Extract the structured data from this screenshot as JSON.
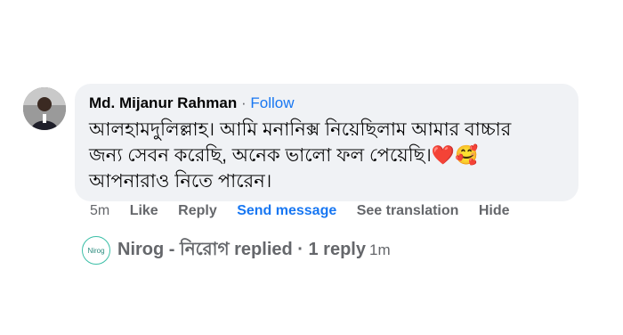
{
  "comment": {
    "author": "Md. Mijanur Rahman",
    "separator": "·",
    "follow_label": "Follow",
    "text_line1": "আলহামদুলিল্লাহ। আমি মনানিক্স নিয়েছিলাম আমার বাচ্চার",
    "text_line2": "জন্য সেবন করেছি, অনেক ভালো ফল পেয়েছি।",
    "text_line3": "আপনারাও নিতে পারেন।",
    "emoji1": "❤️",
    "emoji2": "🥰"
  },
  "actions": {
    "time": "5m",
    "like": "Like",
    "reply": "Reply",
    "send_message": "Send message",
    "see_translation": "See translation",
    "hide": "Hide"
  },
  "reply_summary": {
    "avatar_text": "Nirog",
    "text": "Nirog - নিরোগ replied · 1 reply",
    "time": "1m"
  },
  "colors": {
    "link_blue": "#1877f2",
    "bubble_bg": "#f0f2f5",
    "meta_gray": "#65676b"
  }
}
